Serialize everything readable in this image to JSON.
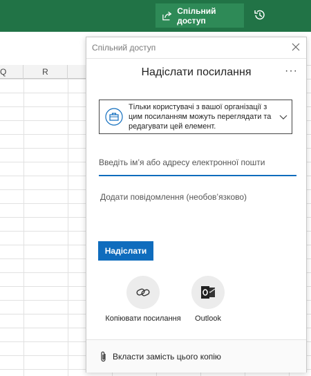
{
  "topbar": {
    "share_label": "Спільний доступ",
    "brand_color": "#217346"
  },
  "sheet": {
    "columns": [
      "Q",
      "R"
    ]
  },
  "panel": {
    "header_title": "Спільний доступ",
    "title": "Надіслати посилання",
    "permission_text": "Тільки користувачі з вашої організації з цим посиланням можуть переглядати та редагувати цей елемент.",
    "recipient_placeholder": "Введіть ім’я або адресу електронної пошти",
    "message_placeholder": "Додати повідомлення (необов’язково)",
    "send_label": "Надіслати",
    "accent_color": "#0f6cbd",
    "actions": [
      {
        "label": "Копіювати посилання",
        "icon": "link-icon"
      },
      {
        "label": "Outlook",
        "icon": "outlook-icon"
      }
    ],
    "attach_label": "Вкласти замість цього копію"
  }
}
